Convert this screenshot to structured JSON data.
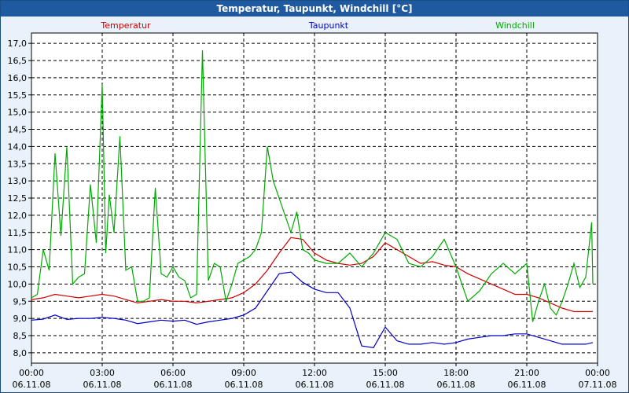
{
  "window": {
    "title": "Temperatur, Taupunkt, Windchill [°C]"
  },
  "colors": {
    "titlebar": "#1f5aa0",
    "background": "#e9f2fa",
    "grid": "#000000",
    "temperatur": "#d00000",
    "taupunkt": "#0000c8",
    "windchill": "#00aa00"
  },
  "chart_data": {
    "type": "line",
    "title": "Temperatur, Taupunkt, Windchill [°C]",
    "xlabel": "",
    "ylabel": "",
    "ylim": [
      7.7,
      17.3
    ],
    "xlim": [
      0,
      24
    ],
    "grid": true,
    "legend_placement": "top",
    "y_ticks": [
      "8,0",
      "8,5",
      "9,0",
      "9,5",
      "10,0",
      "10,5",
      "11,0",
      "11,5",
      "12,0",
      "12,5",
      "13,0",
      "13,5",
      "14,0",
      "14,5",
      "15,0",
      "15,5",
      "16,0",
      "16,5",
      "17,0"
    ],
    "y_tick_values": [
      8.0,
      8.5,
      9.0,
      9.5,
      10.0,
      10.5,
      11.0,
      11.5,
      12.0,
      12.5,
      13.0,
      13.5,
      14.0,
      14.5,
      15.0,
      15.5,
      16.0,
      16.5,
      17.0
    ],
    "x_ticks": [
      {
        "time": "00:00",
        "date": "06.11.08"
      },
      {
        "time": "03:00",
        "date": "06.11.08"
      },
      {
        "time": "06:00",
        "date": "06.11.08"
      },
      {
        "time": "09:00",
        "date": "06.11.08"
      },
      {
        "time": "12:00",
        "date": "06.11.08"
      },
      {
        "time": "15:00",
        "date": "06.11.08"
      },
      {
        "time": "18:00",
        "date": "06.11.08"
      },
      {
        "time": "21:00",
        "date": "06.11.08"
      },
      {
        "time": "00:00",
        "date": "07.11.08"
      }
    ],
    "x_tick_hours": [
      0,
      3,
      6,
      9,
      12,
      15,
      18,
      21,
      24
    ],
    "series": [
      {
        "name": "Temperatur",
        "color": "#d00000",
        "x": [
          0,
          0.5,
          1,
          1.5,
          2,
          2.5,
          3,
          3.5,
          4,
          4.5,
          5,
          5.5,
          6,
          6.5,
          7,
          7.5,
          8,
          8.5,
          9,
          9.5,
          10,
          10.5,
          11,
          11.5,
          12,
          12.5,
          13,
          13.5,
          14,
          14.5,
          15,
          15.5,
          16,
          16.5,
          17,
          17.5,
          18,
          18.5,
          19,
          19.5,
          20,
          20.5,
          21,
          21.5,
          22,
          22.5,
          23,
          23.5,
          23.8
        ],
        "values": [
          9.55,
          9.6,
          9.7,
          9.65,
          9.6,
          9.65,
          9.7,
          9.65,
          9.55,
          9.45,
          9.5,
          9.55,
          9.5,
          9.5,
          9.45,
          9.5,
          9.55,
          9.6,
          9.75,
          10.0,
          10.4,
          10.9,
          11.35,
          11.3,
          10.9,
          10.7,
          10.6,
          10.55,
          10.6,
          10.8,
          11.2,
          11.0,
          10.8,
          10.6,
          10.65,
          10.55,
          10.5,
          10.3,
          10.15,
          10.0,
          9.85,
          9.7,
          9.7,
          9.6,
          9.45,
          9.3,
          9.2,
          9.2,
          9.2
        ]
      },
      {
        "name": "Taupunkt",
        "color": "#0000c8",
        "x": [
          0,
          0.5,
          1,
          1.5,
          2,
          2.5,
          3,
          3.5,
          4,
          4.5,
          5,
          5.5,
          6,
          6.5,
          7,
          7.5,
          8,
          8.5,
          9,
          9.5,
          10,
          10.5,
          11,
          11.5,
          12,
          12.5,
          13,
          13.5,
          14,
          14.5,
          15,
          15.5,
          16,
          16.5,
          17,
          17.5,
          18,
          18.5,
          19,
          19.5,
          20,
          20.5,
          21,
          21.5,
          22,
          22.5,
          23,
          23.5,
          23.8
        ],
        "values": [
          8.95,
          8.98,
          9.1,
          8.97,
          9.0,
          9.0,
          9.03,
          9.0,
          8.95,
          8.85,
          8.9,
          8.95,
          8.92,
          8.95,
          8.83,
          8.9,
          8.95,
          9.0,
          9.1,
          9.3,
          9.8,
          10.3,
          10.35,
          10.05,
          9.85,
          9.75,
          9.75,
          9.3,
          8.2,
          8.15,
          8.75,
          8.35,
          8.25,
          8.25,
          8.3,
          8.25,
          8.3,
          8.4,
          8.45,
          8.5,
          8.5,
          8.55,
          8.55,
          8.45,
          8.35,
          8.25,
          8.25,
          8.25,
          8.3
        ]
      },
      {
        "name": "Windchill",
        "color": "#00aa00",
        "x": [
          0,
          0.25,
          0.5,
          0.75,
          1,
          1.25,
          1.5,
          1.75,
          2,
          2.25,
          2.5,
          2.75,
          3,
          3.15,
          3.3,
          3.5,
          3.75,
          4,
          4.25,
          4.5,
          4.75,
          5,
          5.25,
          5.5,
          5.75,
          6,
          6.25,
          6.5,
          6.75,
          7,
          7.25,
          7.5,
          7.75,
          8,
          8.25,
          8.5,
          8.75,
          9,
          9.25,
          9.5,
          9.75,
          10,
          10.25,
          10.5,
          10.75,
          11,
          11.25,
          11.5,
          11.75,
          12,
          12.5,
          13,
          13.5,
          14,
          14.5,
          15,
          15.5,
          16,
          16.5,
          17,
          17.5,
          18,
          18.5,
          19,
          19.5,
          20,
          20.5,
          21,
          21.25,
          21.5,
          21.75,
          22,
          22.25,
          22.5,
          22.75,
          23,
          23.25,
          23.5,
          23.75,
          23.8
        ],
        "values": [
          9.6,
          9.7,
          11.0,
          10.4,
          13.8,
          11.4,
          14.0,
          10.0,
          10.2,
          10.3,
          12.9,
          11.2,
          15.8,
          10.9,
          12.6,
          11.5,
          14.3,
          10.4,
          10.5,
          9.5,
          9.5,
          9.6,
          12.8,
          10.3,
          10.2,
          10.5,
          10.2,
          10.1,
          9.6,
          9.7,
          16.8,
          10.1,
          10.6,
          10.5,
          9.5,
          10.0,
          10.6,
          10.7,
          10.8,
          11.0,
          11.5,
          14.0,
          13.0,
          12.5,
          12.0,
          11.5,
          12.1,
          11.0,
          10.9,
          10.7,
          10.6,
          10.6,
          10.9,
          10.5,
          10.9,
          11.5,
          11.3,
          10.6,
          10.5,
          10.8,
          11.3,
          10.5,
          9.5,
          9.8,
          10.3,
          10.6,
          10.3,
          10.6,
          8.9,
          9.5,
          10.0,
          9.3,
          9.1,
          9.5,
          10.0,
          10.6,
          9.9,
          10.2,
          11.8,
          10.0
        ]
      }
    ]
  }
}
